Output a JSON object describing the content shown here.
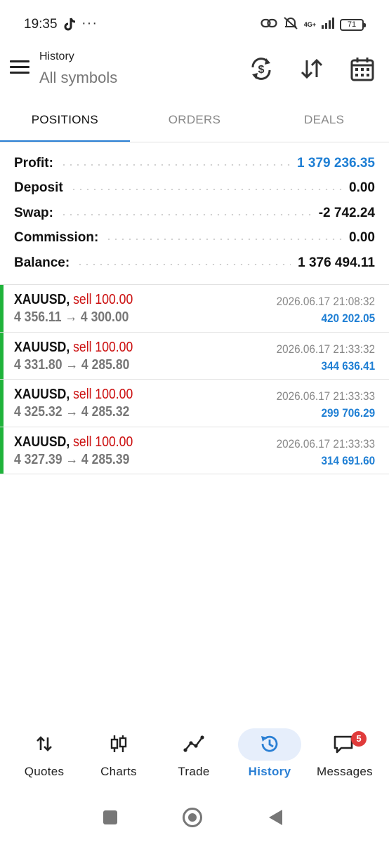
{
  "status_bar": {
    "time": "19:35",
    "dots": "···",
    "network": "4G+",
    "battery": "71"
  },
  "header": {
    "title": "History",
    "subtitle": "All symbols"
  },
  "tabs": [
    {
      "label": "POSITIONS",
      "active": true
    },
    {
      "label": "ORDERS",
      "active": false
    },
    {
      "label": "DEALS",
      "active": false
    }
  ],
  "summary": [
    {
      "label": "Profit:",
      "value": "1 379 236.35",
      "highlight": true
    },
    {
      "label": "Deposit",
      "value": "0.00",
      "highlight": false
    },
    {
      "label": "Swap:",
      "value": "-2 742.24",
      "highlight": false
    },
    {
      "label": "Commission:",
      "value": "0.00",
      "highlight": false
    },
    {
      "label": "Balance:",
      "value": "1 376 494.11",
      "highlight": false
    }
  ],
  "trades": [
    {
      "symbol": "XAUUSD,",
      "side": "sell 100.00",
      "prices": "4 356.11 → 4 300.00",
      "datetime": "2026.06.17 21:08:32",
      "profit": "420 202.05"
    },
    {
      "symbol": "XAUUSD,",
      "side": "sell 100.00",
      "prices": "4 331.80 → 4 285.80",
      "datetime": "2026.06.17 21:33:32",
      "profit": "344 636.41"
    },
    {
      "symbol": "XAUUSD,",
      "side": "sell 100.00",
      "prices": "4 325.32 → 4 285.32",
      "datetime": "2026.06.17 21:33:33",
      "profit": "299 706.29"
    },
    {
      "symbol": "XAUUSD,",
      "side": "sell 100.00",
      "prices": "4 327.39 → 4 285.39",
      "datetime": "2026.06.17 21:33:33",
      "profit": "314 691.60"
    }
  ],
  "bottom_nav": [
    {
      "label": "Quotes",
      "icon": "quotes-icon",
      "active": false
    },
    {
      "label": "Charts",
      "icon": "charts-icon",
      "active": false
    },
    {
      "label": "Trade",
      "icon": "trade-icon",
      "active": false
    },
    {
      "label": "History",
      "icon": "history-icon",
      "active": true
    },
    {
      "label": "Messages",
      "icon": "messages-icon",
      "active": false,
      "badge": "5"
    }
  ],
  "colors": {
    "accent": "#2a7fd4",
    "profit_blue": "#1f7fd4",
    "sell_red": "#cc1111",
    "position_bar": "#1fb33a",
    "badge_red": "#e03b3b"
  }
}
